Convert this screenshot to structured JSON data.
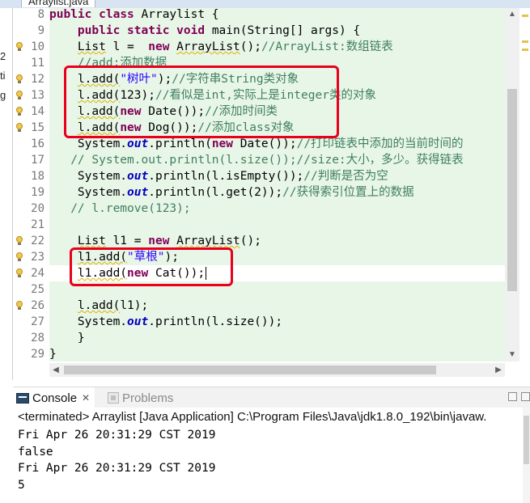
{
  "editor": {
    "tab_title": "Arraylist.java",
    "scroll": {
      "up_arrow": "▲",
      "down_arrow": "▼",
      "left_arrow": "◀",
      "right_arrow": "▶"
    },
    "lines": [
      {
        "num": "8",
        "marker": false,
        "segments": [
          {
            "t": "public",
            "c": "kw"
          },
          {
            "t": " "
          },
          {
            "t": "class",
            "c": "kw"
          },
          {
            "t": " Arraylist {"
          }
        ]
      },
      {
        "num": "9",
        "marker": false,
        "fold": "⊖",
        "segments": [
          {
            "t": "    "
          },
          {
            "t": "public",
            "c": "kw"
          },
          {
            "t": " "
          },
          {
            "t": "static",
            "c": "kw"
          },
          {
            "t": " "
          },
          {
            "t": "void",
            "c": "kw"
          },
          {
            "t": " main(String[] args) {"
          }
        ]
      },
      {
        "num": "10",
        "marker": true,
        "segments": [
          {
            "t": "    "
          },
          {
            "t": "List",
            "c": "warn"
          },
          {
            "t": " l =  "
          },
          {
            "t": "new",
            "c": "kw"
          },
          {
            "t": " "
          },
          {
            "t": "ArrayList",
            "c": "warn"
          },
          {
            "t": "();"
          },
          {
            "t": "//ArrayList:数组链表",
            "c": "cmt"
          }
        ]
      },
      {
        "num": "11",
        "marker": false,
        "segments": [
          {
            "t": "    "
          },
          {
            "t": "//add:添加数据",
            "c": "cmt"
          }
        ]
      },
      {
        "num": "12",
        "marker": true,
        "segments": [
          {
            "t": "    "
          },
          {
            "t": "l.add(",
            "c": "warn"
          },
          {
            "t": "\"树叶\"",
            "c": "str"
          },
          {
            "t": ");"
          },
          {
            "t": "//字符串String类对象",
            "c": "cmt"
          }
        ]
      },
      {
        "num": "13",
        "marker": true,
        "segments": [
          {
            "t": "    "
          },
          {
            "t": "l.add(",
            "c": "warn"
          },
          {
            "t": "123);"
          },
          {
            "t": "//看似是int,实际上是integer类的对象",
            "c": "cmt"
          }
        ]
      },
      {
        "num": "14",
        "marker": true,
        "segments": [
          {
            "t": "    "
          },
          {
            "t": "l.add(",
            "c": "warn"
          },
          {
            "t": "new",
            "c": "kw"
          },
          {
            "t": " Date());"
          },
          {
            "t": "//添加时间类",
            "c": "cmt"
          }
        ]
      },
      {
        "num": "15",
        "marker": true,
        "segments": [
          {
            "t": "    "
          },
          {
            "t": "l.add(",
            "c": "warn"
          },
          {
            "t": "new",
            "c": "kw"
          },
          {
            "t": " Dog());"
          },
          {
            "t": "//添加class对象",
            "c": "cmt"
          }
        ]
      },
      {
        "num": "16",
        "marker": false,
        "segments": [
          {
            "t": "    System."
          },
          {
            "t": "out",
            "c": "fld"
          },
          {
            "t": ".println("
          },
          {
            "t": "new",
            "c": "kw"
          },
          {
            "t": " Date());"
          },
          {
            "t": "//打印链表中添加的当前时间的",
            "c": "cmt"
          }
        ]
      },
      {
        "num": "17",
        "marker": false,
        "segments": [
          {
            "t": "   "
          },
          {
            "t": "// System.out.println(l.size());//size:大小，多少。获得链表",
            "c": "cmt"
          }
        ]
      },
      {
        "num": "18",
        "marker": false,
        "segments": [
          {
            "t": "    System."
          },
          {
            "t": "out",
            "c": "fld"
          },
          {
            "t": ".println(l.isEmpty());"
          },
          {
            "t": "//判断是否为空",
            "c": "cmt"
          }
        ]
      },
      {
        "num": "19",
        "marker": false,
        "segments": [
          {
            "t": "    System."
          },
          {
            "t": "out",
            "c": "fld"
          },
          {
            "t": ".println(l.get(2));"
          },
          {
            "t": "//获得索引位置上的数据",
            "c": "cmt"
          }
        ]
      },
      {
        "num": "20",
        "marker": false,
        "segments": [
          {
            "t": "   "
          },
          {
            "t": "// l.remove(123);",
            "c": "cmt"
          }
        ]
      },
      {
        "num": "21",
        "marker": false,
        "segments": [
          {
            "t": ""
          }
        ]
      },
      {
        "num": "22",
        "marker": true,
        "segments": [
          {
            "t": "    "
          },
          {
            "t": "List",
            "c": "warn"
          },
          {
            "t": " l1 = "
          },
          {
            "t": "new",
            "c": "kw"
          },
          {
            "t": " "
          },
          {
            "t": "ArrayList",
            "c": "warn"
          },
          {
            "t": "();"
          }
        ]
      },
      {
        "num": "23",
        "marker": true,
        "segments": [
          {
            "t": "    "
          },
          {
            "t": "l1.add(",
            "c": "warn"
          },
          {
            "t": "\"草根\"",
            "c": "str"
          },
          {
            "t": ");"
          }
        ]
      },
      {
        "num": "24",
        "marker": true,
        "current": true,
        "segments": [
          {
            "t": "    "
          },
          {
            "t": "l1.add(",
            "c": "warn"
          },
          {
            "t": "new",
            "c": "kw"
          },
          {
            "t": " Cat());"
          }
        ]
      },
      {
        "num": "25",
        "marker": false,
        "segments": [
          {
            "t": ""
          }
        ]
      },
      {
        "num": "26",
        "marker": true,
        "segments": [
          {
            "t": "    "
          },
          {
            "t": "l.add(",
            "c": "warn"
          },
          {
            "t": "l1);"
          }
        ]
      },
      {
        "num": "27",
        "marker": false,
        "segments": [
          {
            "t": "    System."
          },
          {
            "t": "out",
            "c": "fld"
          },
          {
            "t": ".println(l.size());"
          }
        ]
      },
      {
        "num": "28",
        "marker": false,
        "segments": [
          {
            "t": "    }"
          }
        ]
      },
      {
        "num": "29",
        "marker": false,
        "segments": [
          {
            "t": "}"
          }
        ]
      }
    ]
  },
  "left_panel": {
    "chars": [
      "2",
      "ti",
      "g"
    ]
  },
  "console": {
    "tab_label": "Console",
    "tab_close": "✕",
    "problems_label": "Problems",
    "terminated_line": "<terminated> Arraylist [Java Application] C:\\Program Files\\Java\\jdk1.8.0_192\\bin\\javaw.",
    "output": [
      "Fri Apr 26 20:31:29 CST 2019",
      "false",
      "Fri Apr 26 20:31:29 CST 2019",
      "5"
    ]
  },
  "colors": {
    "keyword": "#7f0055",
    "string": "#2a00ff",
    "comment": "#3f7f5f",
    "field": "#0000c0",
    "highlight_box": "#e8001c",
    "code_background": "#e8f6e8"
  }
}
